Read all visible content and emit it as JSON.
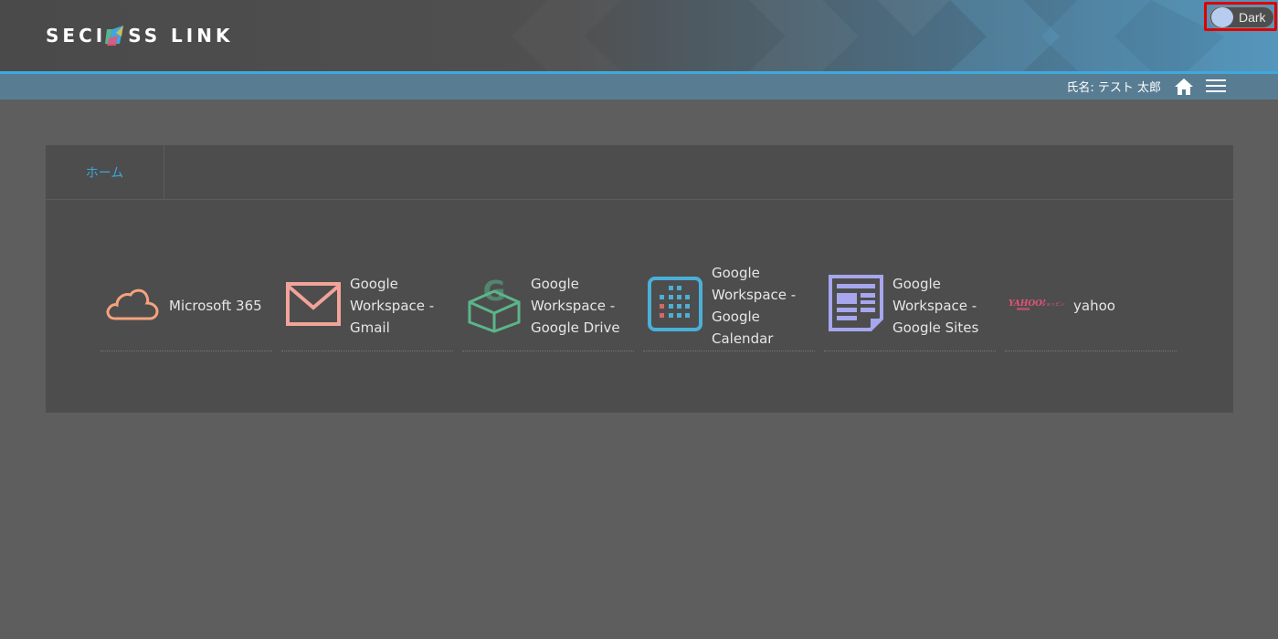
{
  "header": {
    "logo_text_left": "SECI",
    "logo_text_right": "SS LINK",
    "theme_toggle_label": "Dark"
  },
  "subbar": {
    "user_label": "氏名: テスト 太郎"
  },
  "tabs": [
    {
      "label": "ホーム"
    }
  ],
  "apps": [
    {
      "label": "Microsoft 365",
      "icon": "cloud-icon",
      "color": "#f4a37d"
    },
    {
      "label": "Google Workspace - Gmail",
      "icon": "envelope-icon",
      "color": "#f2a39a"
    },
    {
      "label": "Google Workspace - Google Drive",
      "icon": "box-icon",
      "color": "#5bb58a"
    },
    {
      "label": "Google Workspace - Google Calendar",
      "icon": "calendar-icon",
      "color": "#4ab0d8"
    },
    {
      "label": "Google Workspace - Google Sites",
      "icon": "document-icon",
      "color": "#a7a6ee"
    },
    {
      "label": "yahoo",
      "icon": "yahoo-logo",
      "logo_text": "YAHOO!",
      "logo_subtext": "ショッピング",
      "color": "#e8537a"
    }
  ],
  "colors": {
    "accent": "#3fa8dd",
    "background": "#5e5e5e",
    "panel": "#4d4d4d"
  }
}
